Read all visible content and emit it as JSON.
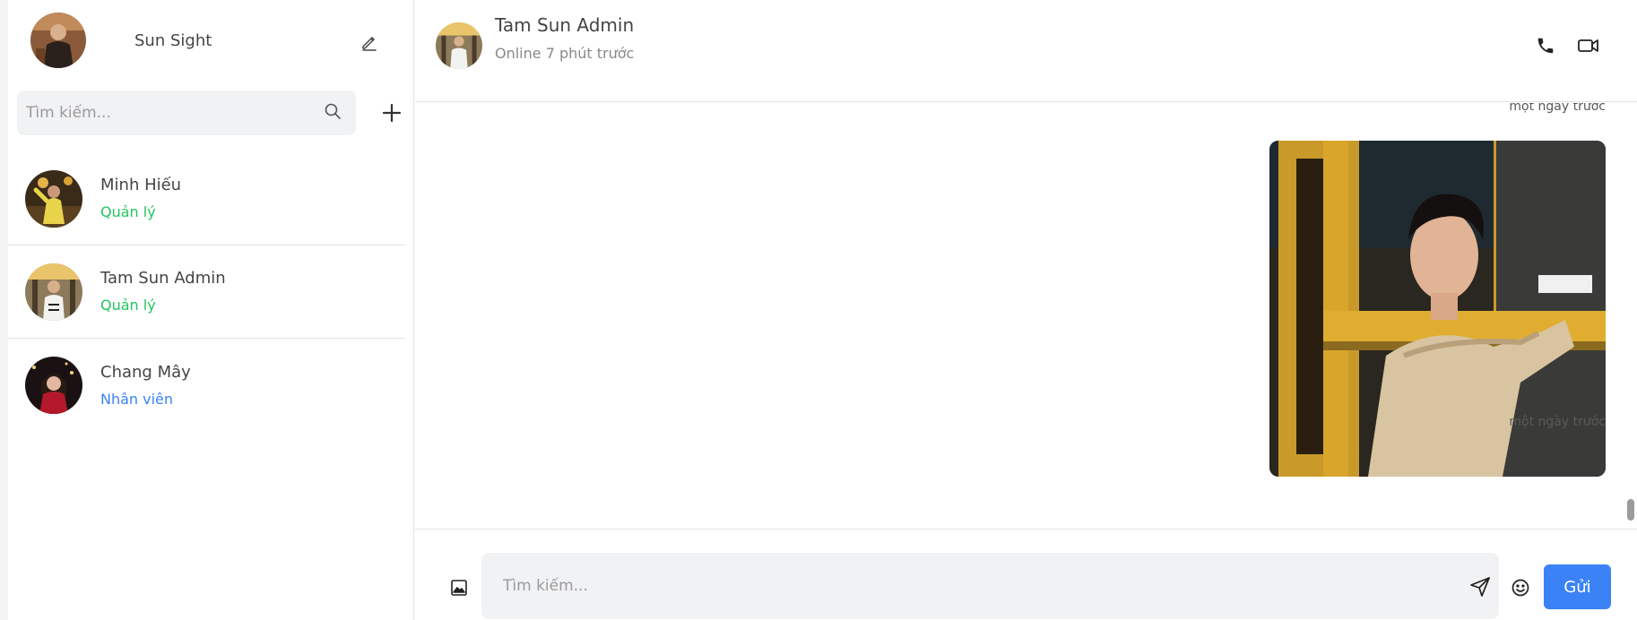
{
  "current_user": {
    "name": "Sun Sight"
  },
  "search": {
    "placeholder": "Tìm kiếm..."
  },
  "contacts": [
    {
      "name": "Minh Hiếu",
      "role": "Quản lý",
      "role_color": "#22c55e"
    },
    {
      "name": "Tam Sun Admin",
      "role": "Quản lý",
      "role_color": "#22c55e"
    },
    {
      "name": "Chang Mây",
      "role": "Nhân viên",
      "role_color": "#3b82f6"
    }
  ],
  "chat": {
    "peer_name": "Tam Sun Admin",
    "peer_status": "Online 7 phút trước",
    "messages": [
      {
        "type": "image",
        "time": "một ngày trước"
      }
    ],
    "earlier_time": "một ngày trước"
  },
  "composer": {
    "placeholder": "Tìm kiếm...",
    "send_label": "Gửi"
  },
  "colors": {
    "accent": "#3b82f6",
    "manager": "#22c55e",
    "staff": "#3b82f6"
  },
  "icons": [
    "edit-icon",
    "search-icon",
    "plus-icon",
    "phone-icon",
    "video-icon",
    "image-icon",
    "send-icon",
    "emoji-icon"
  ]
}
